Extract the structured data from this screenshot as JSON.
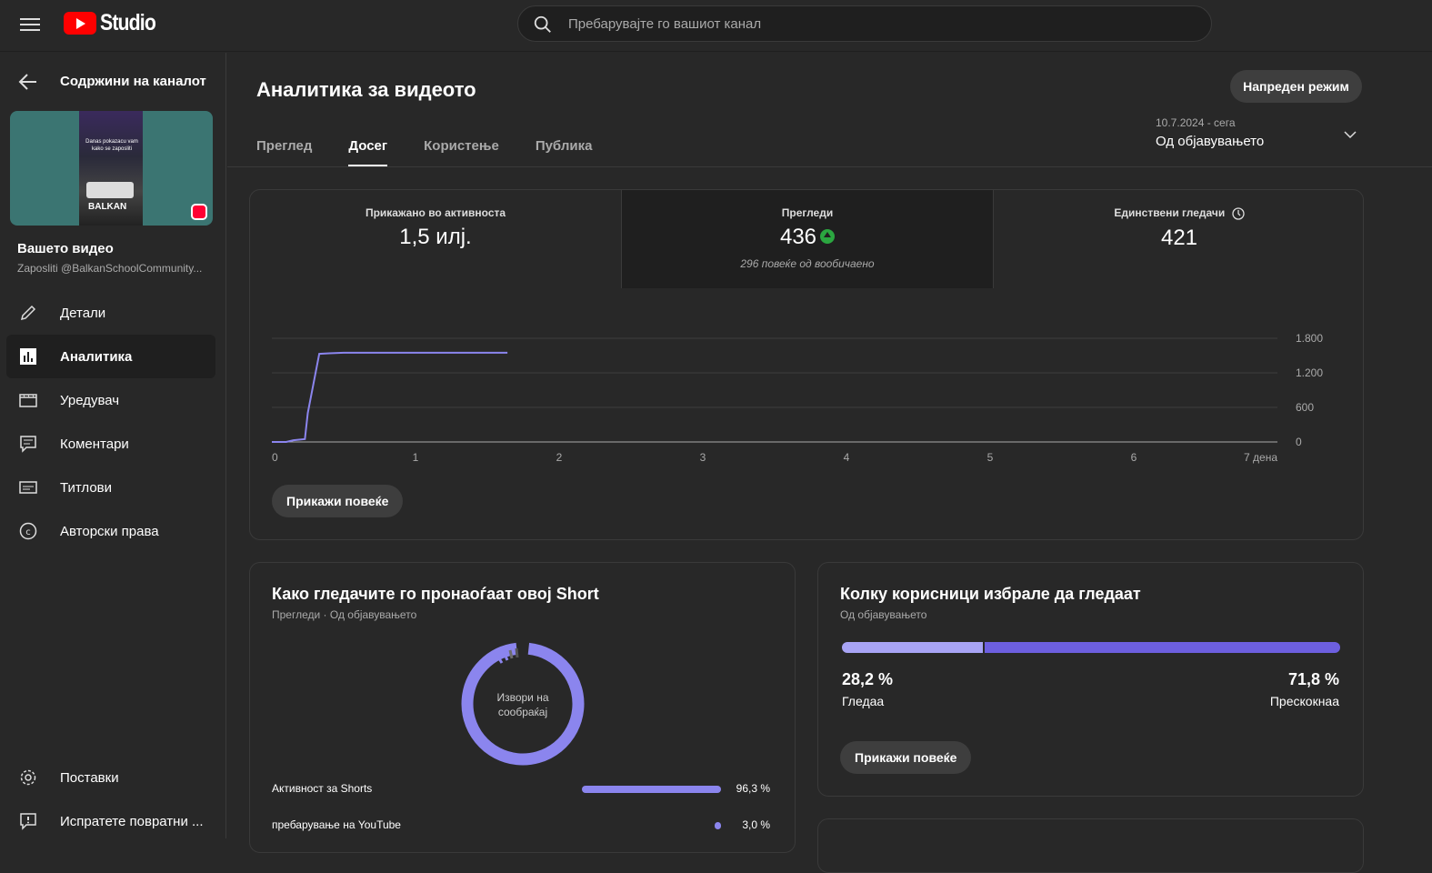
{
  "header": {
    "brand": "Studio",
    "search_placeholder": "Пребарувајте го вашиот канал"
  },
  "sidebar": {
    "title": "Содржини на каналот",
    "video_title": "Вашето видео",
    "video_subtitle": "Zaposliti @BalkanSchoolCommunity...",
    "thumbnail_text": "Danas pokazacu vam kako se zaposliti",
    "thumbnail_brand": "BALKAN",
    "items": [
      {
        "label": "Детали",
        "icon": "pencil-icon"
      },
      {
        "label": "Аналитика",
        "icon": "analytics-icon",
        "active": true
      },
      {
        "label": "Уредувач",
        "icon": "editor-icon"
      },
      {
        "label": "Коментари",
        "icon": "comments-icon"
      },
      {
        "label": "Титлови",
        "icon": "subtitles-icon"
      },
      {
        "label": "Авторски права",
        "icon": "copyright-icon"
      }
    ],
    "bottom_items": [
      {
        "label": "Поставки",
        "icon": "gear-icon"
      },
      {
        "label": "Испратете повратни ...",
        "icon": "feedback-icon"
      }
    ]
  },
  "main": {
    "title": "Аналитика за видеото",
    "advanced_button": "Напреден режим",
    "tabs": [
      {
        "label": "Преглед",
        "active": false
      },
      {
        "label": "Досег",
        "active": true
      },
      {
        "label": "Користење",
        "active": false
      },
      {
        "label": "Публика",
        "active": false
      }
    ],
    "date_range": {
      "dates": "10.7.2024 - сега",
      "label": "Од објавувањето"
    }
  },
  "metrics": [
    {
      "label": "Прикажано во активноста",
      "value": "1,5 илј."
    },
    {
      "label": "Прегледи",
      "value": "436",
      "note": "296 повеќе од вообичаено",
      "trend": "up"
    },
    {
      "label": "Единствени гледачи",
      "value": "421"
    }
  ],
  "chart_data": {
    "type": "line",
    "x": [
      0,
      0.1,
      0.15,
      0.23,
      0.25,
      0.33,
      0.4,
      0.5,
      0.8,
      1.0,
      1.3,
      1.64
    ],
    "y": [
      0,
      0,
      30,
      50,
      500,
      1530,
      1540,
      1550,
      1550,
      1550,
      1550,
      1550
    ],
    "x_ticks": [
      "0",
      "1",
      "2",
      "3",
      "4",
      "5",
      "6",
      "7 дена"
    ],
    "y_ticks": [
      "0",
      "600",
      "1.200",
      "1.800"
    ],
    "xlim": [
      0,
      7
    ],
    "ylim": [
      0,
      1800
    ],
    "grid": true,
    "color": "#8b85ee"
  },
  "show_more": "Прикажи повеќе",
  "traffic_card": {
    "title": "Како гледачите го пронаоѓаат овој Short",
    "subtitle": "Прегледи · Од објавувањето",
    "donut_label": "Извори на сообраќај",
    "sources": [
      {
        "label": "Активност за Shorts",
        "value": "96,3 %",
        "pct": 96.3
      },
      {
        "label": "пребарување на YouTube",
        "value": "3,0 %",
        "pct": 3.0
      }
    ]
  },
  "watch_card": {
    "title": "Колку корисници избрале да гледаат",
    "subtitle": "Од објавувањето",
    "watched_pct": "28,2 %",
    "watched_label": "Гледаа",
    "skipped_pct": "71,8 %",
    "skipped_label": "Прескокнаа",
    "watched_fraction": 0.282
  }
}
